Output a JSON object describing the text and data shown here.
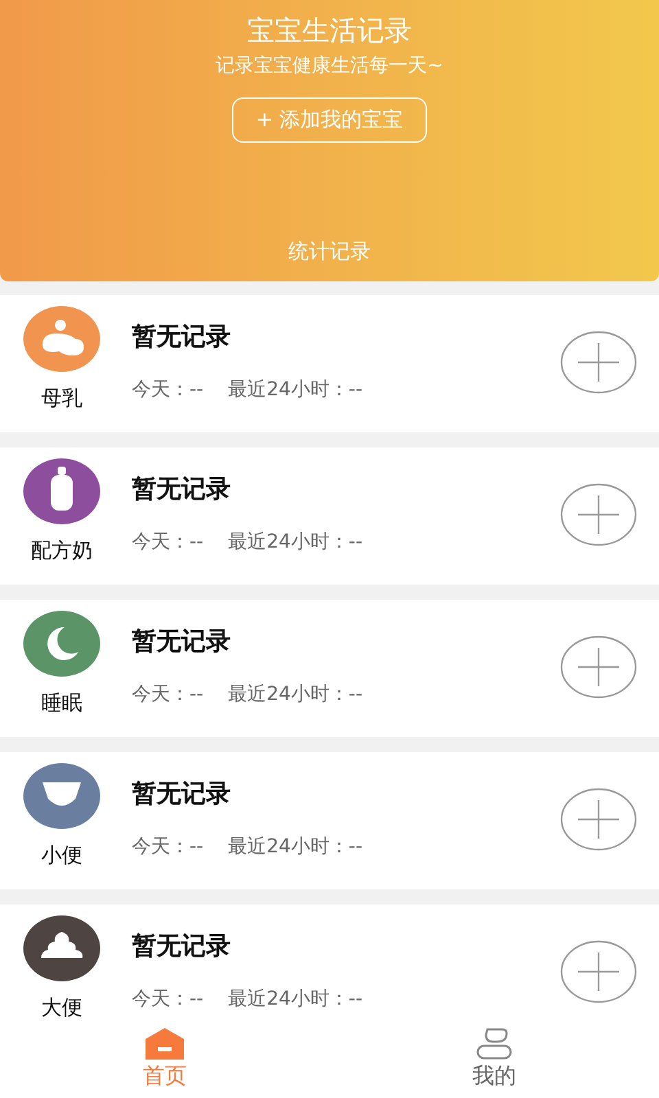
{
  "header": {
    "title": "宝宝生活记录",
    "subtitle": "记录宝宝健康生活每一天~",
    "add_button": "+ 添加我的宝宝",
    "stats_link": "统计记录"
  },
  "records": [
    {
      "kind": "breast",
      "label": "母乳",
      "color": "#f0944f",
      "status": "暂无记录",
      "today": "今天：--",
      "last_24h": "最近24小时：--"
    },
    {
      "kind": "formula",
      "label": "配方奶",
      "color": "#8e4e9e",
      "status": "暂无记录",
      "today": "今天：--",
      "last_24h": "最近24小时：--"
    },
    {
      "kind": "sleep",
      "label": "睡眠",
      "color": "#5a9467",
      "status": "暂无记录",
      "today": "今天：--",
      "last_24h": "最近24小时：--"
    },
    {
      "kind": "pee",
      "label": "小便",
      "color": "#6a7fa0",
      "status": "暂无记录",
      "today": "今天：--",
      "last_24h": "最近24小时：--"
    },
    {
      "kind": "poop",
      "label": "大便",
      "color": "#4e4441",
      "status": "暂无记录",
      "today": "今天：--",
      "last_24h": "最近24小时：--"
    }
  ],
  "tabs": [
    {
      "kind": "home",
      "label": "首页",
      "selected": true
    },
    {
      "kind": "me",
      "label": "我的",
      "selected": false
    }
  ]
}
